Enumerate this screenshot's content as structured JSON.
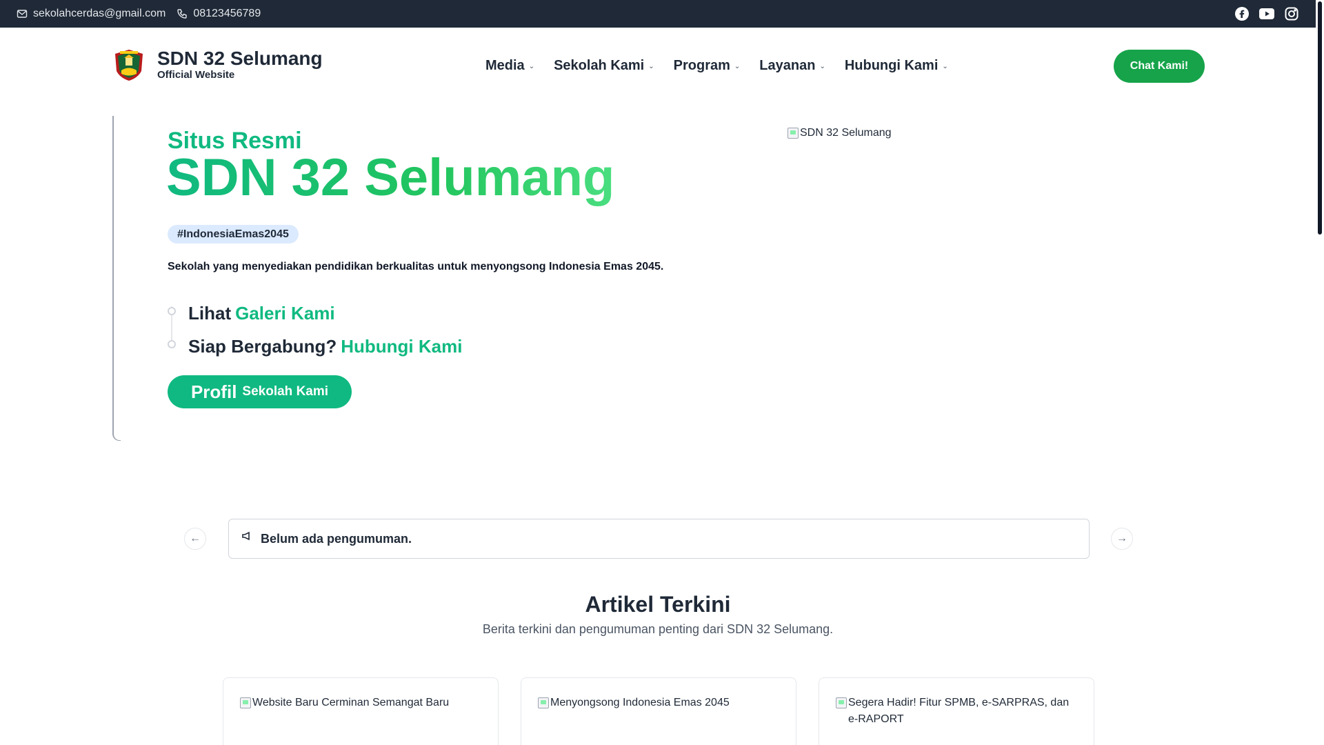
{
  "topbar": {
    "email": "sekolahcerdas@gmail.com",
    "phone": "08123456789",
    "socials": [
      "facebook-icon",
      "youtube-icon",
      "instagram-icon"
    ]
  },
  "header": {
    "school_name": "SDN 32 Selumang",
    "tagline": "Official Website",
    "nav": [
      {
        "label": "Media"
      },
      {
        "label": "Sekolah Kami"
      },
      {
        "label": "Program"
      },
      {
        "label": "Layanan"
      },
      {
        "label": "Hubungi Kami"
      }
    ],
    "chat_label": "Chat Kami!"
  },
  "hero": {
    "eyebrow": "Situs Resmi",
    "title": "SDN 32 Selumang",
    "tag": "#IndonesiaEmas2045",
    "lead": "Sekolah yang menyediakan pendidikan berkualitas untuk menyongsong Indonesia Emas 2045.",
    "cta1_plain": "Lihat",
    "cta1_link": "Galeri Kami",
    "cta2_plain": "Siap Bergabung?",
    "cta2_link": "Hubungi Kami",
    "profile_a": "Profil",
    "profile_b": "Sekolah Kami",
    "image_alt": "SDN 32 Selumang"
  },
  "announcement": {
    "text": "Belum ada pengumuman."
  },
  "articles": {
    "title": "Artikel Terkini",
    "subtitle": "Berita terkini dan pengumuman penting dari SDN 32 Selumang.",
    "items": [
      {
        "image_alt": "Website Baru Cerminan Semangat Baru"
      },
      {
        "image_alt": "Menyongsong Indonesia Emas 2045"
      },
      {
        "image_alt": "Segera Hadir! Fitur SPMB, e-SARPRAS, dan e-RAPORT"
      }
    ]
  },
  "colors": {
    "accent": "#10b981",
    "button": "#16a34a",
    "topbar": "#1f2937",
    "tag_bg": "#dbeafe"
  }
}
